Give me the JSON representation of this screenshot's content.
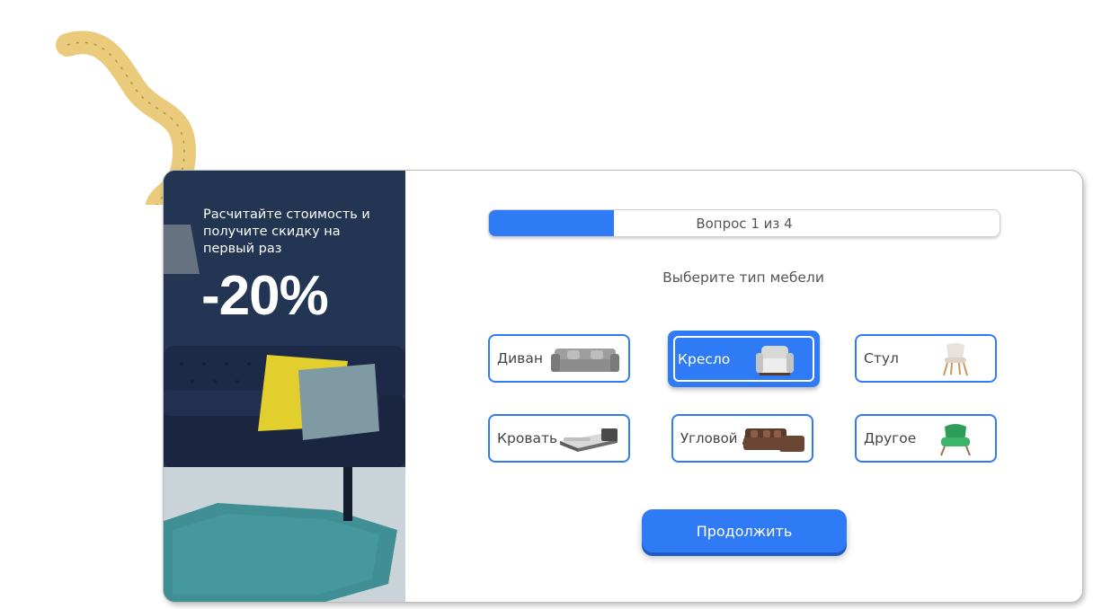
{
  "promo": {
    "text": "Расчитайте стоимость и получите скидку на первый раз",
    "discount": "-20%"
  },
  "progress": {
    "label": "Вопрос 1 из 4",
    "fraction": 0.245
  },
  "question": "Выберите тип мебели",
  "options": [
    {
      "label": "Диван",
      "selected": false,
      "icon": "sofa-image"
    },
    {
      "label": "Кресло",
      "selected": true,
      "icon": "armchair-image"
    },
    {
      "label": "Стул",
      "selected": false,
      "icon": "chair-image"
    },
    {
      "label": "Кровать",
      "selected": false,
      "icon": "bed-image"
    },
    {
      "label": "Угловой диван",
      "selected": false,
      "icon": "corner-sofa-image"
    },
    {
      "label": "Другое",
      "selected": false,
      "icon": "green-armchair-image"
    }
  ],
  "continue_label": "Продолжить",
  "colors": {
    "accent": "#2f7bf5",
    "panel": "#1f2f48"
  }
}
